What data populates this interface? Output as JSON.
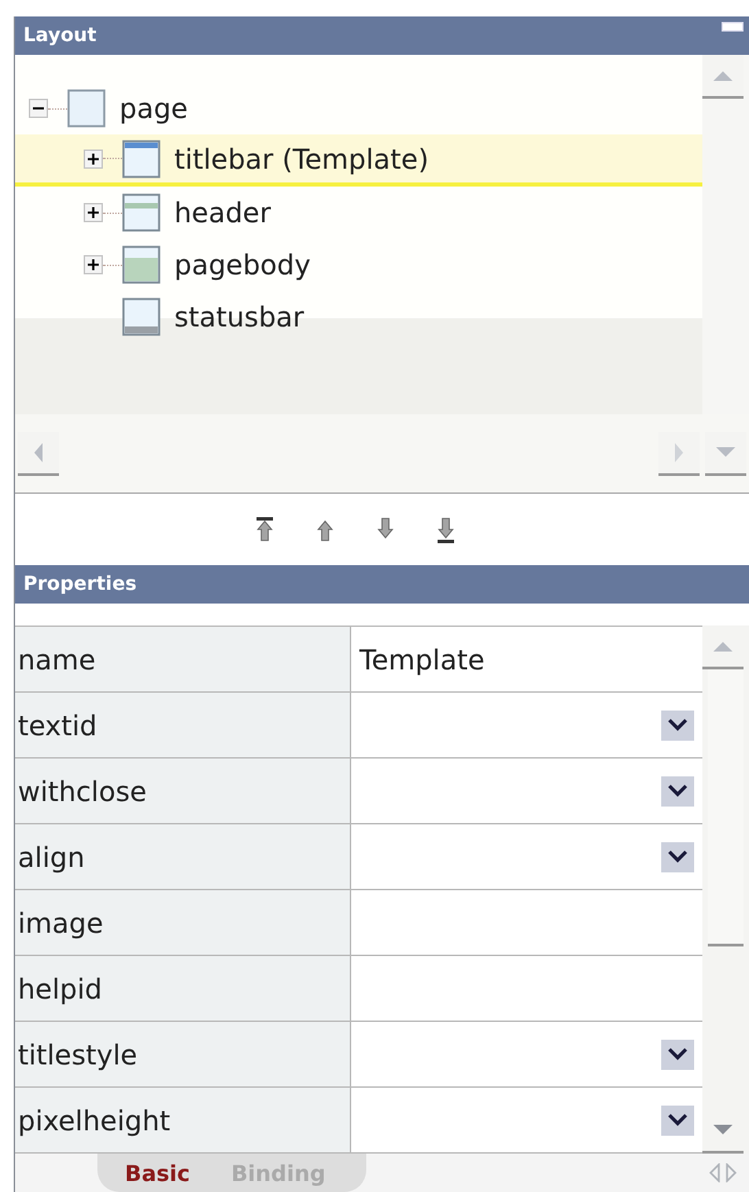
{
  "layout_panel": {
    "title": "Layout",
    "tree": [
      {
        "label": "page",
        "expanded": true,
        "selected": false,
        "children": [
          {
            "label": "titlebar (Template)",
            "expanded": false,
            "kind": "branch",
            "selected": true
          },
          {
            "label": "header",
            "expanded": false,
            "kind": "branch",
            "selected": false
          },
          {
            "label": "pagebody",
            "expanded": false,
            "kind": "branch",
            "selected": false
          },
          {
            "label": "statusbar",
            "kind": "leaf",
            "selected": false
          }
        ]
      }
    ]
  },
  "properties_panel": {
    "title": "Properties",
    "rows": [
      {
        "name": "name",
        "value": "Template",
        "kind": "text"
      },
      {
        "name": "textid",
        "kind": "select"
      },
      {
        "name": "withclose",
        "kind": "select"
      },
      {
        "name": "align",
        "kind": "select"
      },
      {
        "name": "image",
        "kind": "text"
      },
      {
        "name": "helpid",
        "kind": "text"
      },
      {
        "name": "titlestyle",
        "kind": "select"
      },
      {
        "name": "pixelheight",
        "kind": "select"
      }
    ],
    "tabs": [
      {
        "label": "Basic",
        "selected": true
      },
      {
        "label": "Binding",
        "selected": false
      }
    ]
  }
}
